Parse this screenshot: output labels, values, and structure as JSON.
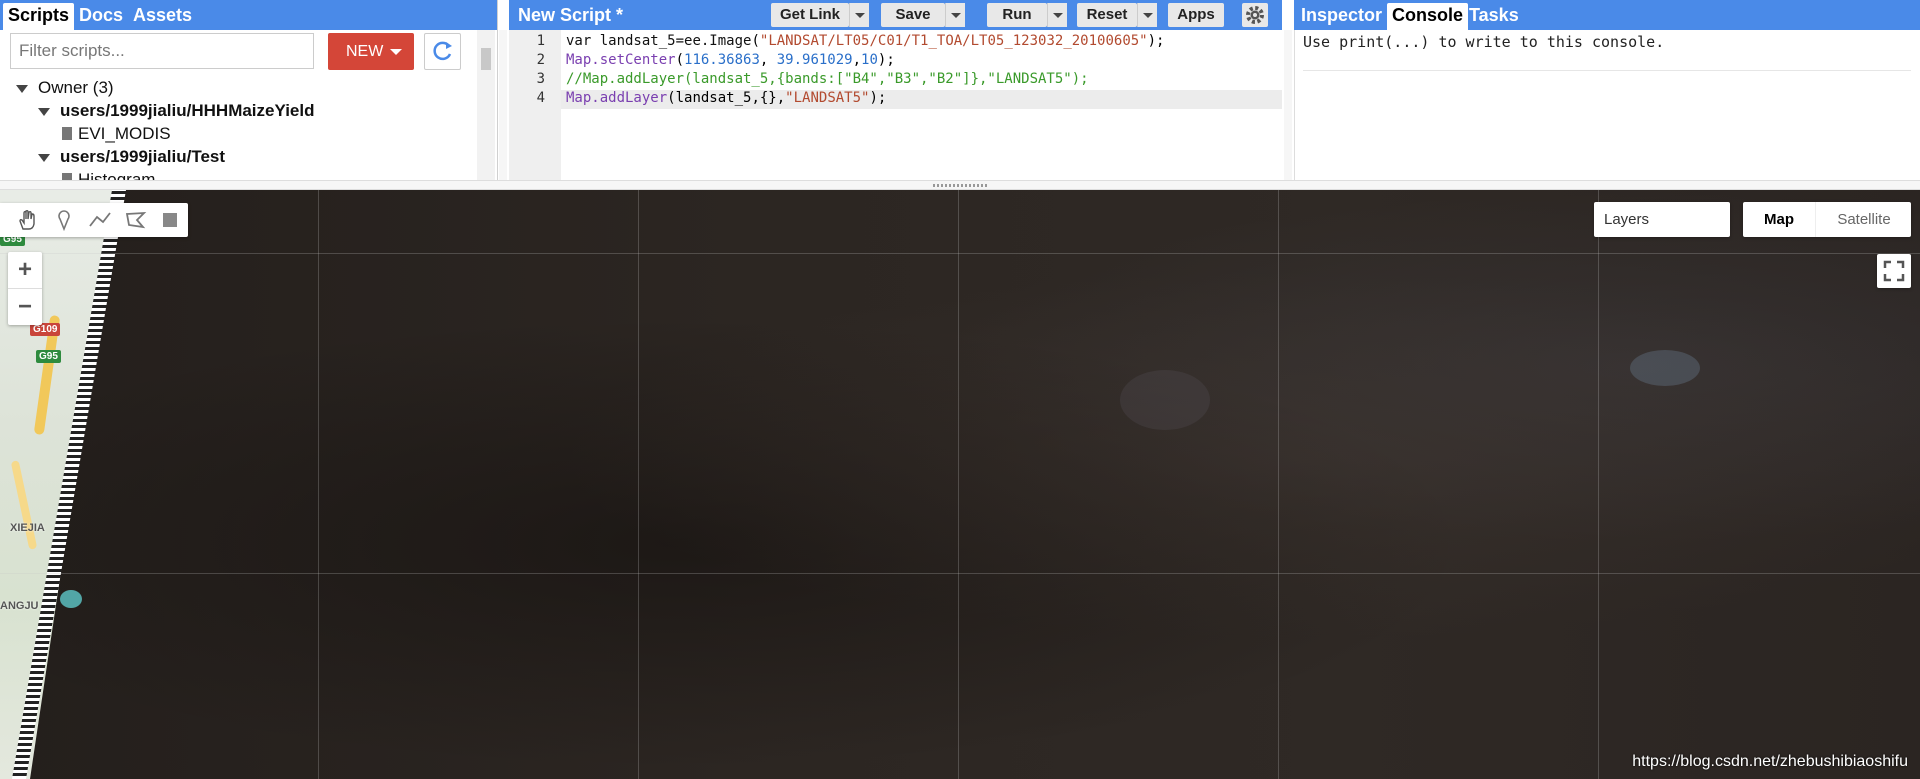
{
  "left_panel": {
    "tabs": [
      {
        "label": "Scripts",
        "active": true
      },
      {
        "label": "Docs",
        "active": false
      },
      {
        "label": "Assets",
        "active": false
      }
    ],
    "filter_placeholder": "Filter scripts...",
    "new_label": "NEW",
    "tree": [
      {
        "label": "Owner (3)"
      },
      {
        "label": "users/1999jialiu/HHHMaizeYield"
      },
      {
        "label": "EVI_MODIS"
      },
      {
        "label": "users/1999jialiu/Test"
      },
      {
        "label": "Histogram"
      }
    ]
  },
  "center_panel": {
    "title": "New Script *",
    "buttons": {
      "get_link": "Get Link",
      "save": "Save",
      "run": "Run",
      "reset": "Reset",
      "apps": "Apps"
    },
    "line_numbers": [
      "1",
      "2",
      "3",
      "4"
    ],
    "active_line": 4,
    "code": [
      [
        {
          "t": "var landsat_5=",
          "c": "kw"
        },
        {
          "t": "ee.Image",
          "c": "kw"
        },
        {
          "t": "(",
          "c": "pl"
        },
        {
          "t": "\"LANDSAT/LT05/C01/T1_TOA/LT05_123032_20100605\"",
          "c": "str"
        },
        {
          "t": ");",
          "c": "pl"
        }
      ],
      [
        {
          "t": "Map.setCenter",
          "c": "fn"
        },
        {
          "t": "(",
          "c": "pl"
        },
        {
          "t": "116.36863",
          "c": "num"
        },
        {
          "t": ", ",
          "c": "pl"
        },
        {
          "t": "39.961029",
          "c": "num"
        },
        {
          "t": ",",
          "c": "pl"
        },
        {
          "t": "10",
          "c": "num"
        },
        {
          "t": ");",
          "c": "pl"
        }
      ],
      [
        {
          "t": "//Map.addLayer(landsat_5,{bands:[\"B4\",\"B3\",\"B2\"]},\"LANDSAT5\");",
          "c": "cmt"
        }
      ],
      [
        {
          "t": "Map.addLayer",
          "c": "fn"
        },
        {
          "t": "(landsat_5,{},",
          "c": "pl"
        },
        {
          "t": "\"LANDSAT5\"",
          "c": "str"
        },
        {
          "t": ");",
          "c": "pl"
        }
      ]
    ]
  },
  "right_panel": {
    "tabs": [
      {
        "label": "Inspector",
        "active": false
      },
      {
        "label": "Console",
        "active": true
      },
      {
        "label": "Tasks",
        "active": false
      }
    ],
    "console_text": "Use print(...) to write to this console."
  },
  "map": {
    "layers_label": "Layers",
    "map_type_options": [
      {
        "label": "Map",
        "active": true
      },
      {
        "label": "Satellite",
        "active": false
      }
    ],
    "zoom_in": "+",
    "zoom_out": "−",
    "road_shields": [
      "G95",
      "G109",
      "G95"
    ],
    "place_labels": [
      "XIEJIA",
      "ANGJU"
    ],
    "watermark": "https://blog.csdn.net/zhebushibiaoshifu"
  },
  "colors": {
    "header_blue": "#4a8ae8",
    "new_button_red": "#d44638",
    "selected_map_type": "#000000"
  }
}
